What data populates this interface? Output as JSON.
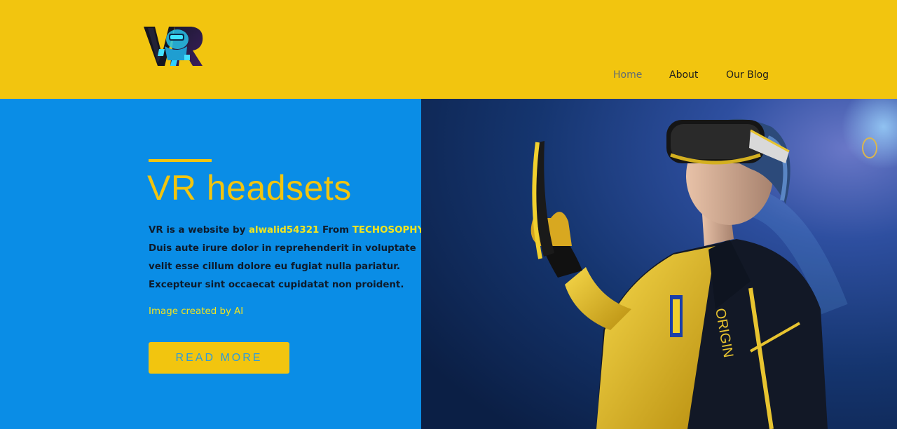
{
  "header": {
    "logo_text": "VR",
    "nav": [
      {
        "label": "Home",
        "active": true
      },
      {
        "label": "About",
        "active": false
      },
      {
        "label": "Our Blog",
        "active": false
      }
    ]
  },
  "hero": {
    "title": "VR headsets",
    "body": {
      "line1_prefix": "VR is a website by ",
      "author": "alwalid54321",
      "line1_mid": " From ",
      "org": "TECHOSOPHY",
      "line2": "Duis aute irure dolor in reprehenderit in voluptate",
      "line3": "velit esse cillum dolore eu fugiat nulla pariatur.",
      "line4": "Excepteur sint occaecat cupidatat non proident."
    },
    "credit": "Image created by AI",
    "button_label": "READ MORE"
  },
  "colors": {
    "header_bg": "#f2c50f",
    "hero_bg": "#0a8de6",
    "accent": "#f2c50f",
    "highlight": "#f2e51e"
  }
}
